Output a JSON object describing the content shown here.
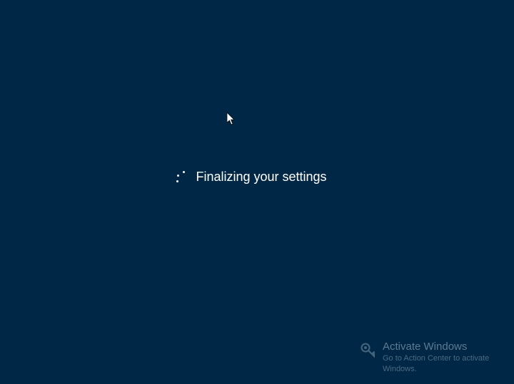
{
  "status": {
    "message": "Finalizing your settings"
  },
  "watermark": {
    "title": "Activate Windows",
    "subtitle": "Go to Action Center to activate Windows."
  }
}
